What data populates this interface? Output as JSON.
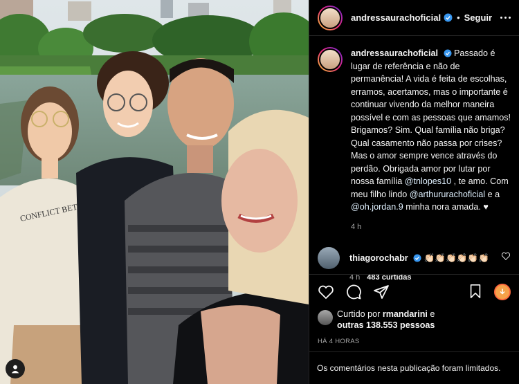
{
  "post": {
    "username": "andressaurachoficial",
    "dot": "•",
    "follow_label": "Seguir",
    "caption_username": "andressaurachoficial",
    "caption_text_1": "Passado é lugar de referência e não de permanência! A vida é feita de escolhas, erramos, acertamos, mas o importante é continuar vivendo da melhor maneira possível e com as pessoas que amamos! Brigamos? Sim. Qual família não briga? Qual casamento não passa por crises? Mas o amor sempre vence através do perdão. Obrigada amor por lutar por nossa família ",
    "mention_1": "@tnlopes10",
    "caption_text_2": " , te amo. Com meu filho lindo ",
    "mention_2": "@arthururachoficial",
    "caption_text_3": " e a ",
    "mention_3": "@oh.jordan.9",
    "caption_text_4": " minha nora amada. ♥",
    "caption_time": "4 h"
  },
  "comment": {
    "username": "thiagorochabr",
    "text": "👏🏻👏🏻👏🏻👏🏻👏🏻👏🏻",
    "time": "4 h",
    "likes": "483 curtidas"
  },
  "likes": {
    "prefix": "Curtido por ",
    "liker": "rmandarini",
    "middle": " e",
    "others": "outras 138.553 pessoas"
  },
  "date_label": "HÁ 4 HORAS",
  "comments_limited": "Os comentários nesta publicação foram limitados.",
  "icons": [
    "verified-icon",
    "more-options-icon",
    "heart-icon",
    "comment-icon",
    "share-icon",
    "bookmark-icon",
    "download-icon",
    "user-tag-icon"
  ],
  "colors": {
    "background": "#000000",
    "verified": "#3897f0",
    "mention": "#e0f1ff",
    "muted": "#a8a8a8",
    "border": "#262626"
  }
}
